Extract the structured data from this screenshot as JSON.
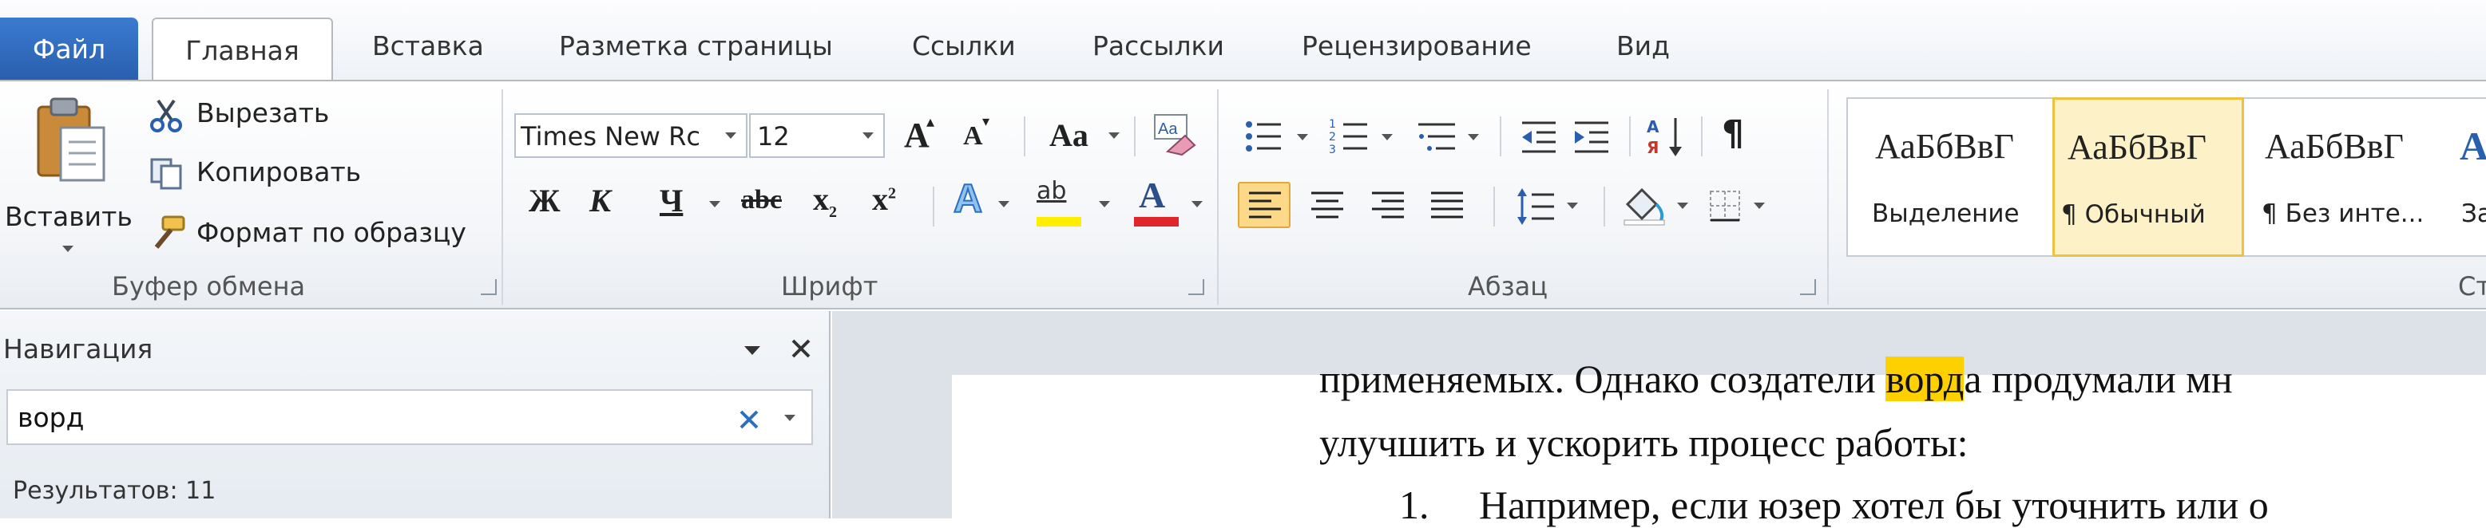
{
  "tabs": {
    "file": "Файл",
    "home": "Главная",
    "insert": "Вставка",
    "layout": "Разметка страницы",
    "references": "Ссылки",
    "mailings": "Рассылки",
    "review": "Рецензирование",
    "view": "Вид"
  },
  "clipboard": {
    "paste": "Вставить",
    "cut": "Вырезать",
    "copy": "Копировать",
    "format_painter": "Формат по образцу",
    "group_label": "Буфер обмена"
  },
  "font": {
    "name": "Times New Rc",
    "size": "12",
    "grow": "A",
    "shrink": "A",
    "case": "Aa",
    "bold": "Ж",
    "italic": "К",
    "underline": "Ч",
    "strike": "abc",
    "subscript": "x",
    "superscript": "x",
    "effects": "A",
    "highlight": "ab",
    "color": "A",
    "group_label": "Шрифт"
  },
  "paragraph": {
    "sort": "А Я",
    "pilcrow": "¶",
    "group_label": "Абзац"
  },
  "styles": {
    "items": [
      {
        "sample": "АаБбВвГ",
        "label": "Выделение"
      },
      {
        "sample": "АаБбВвГ",
        "label": "¶ Обычный"
      },
      {
        "sample": "АаБбВвГ",
        "label": "¶ Без инте..."
      },
      {
        "sample": "Aa",
        "label": "Заг"
      }
    ],
    "group_label": "Ст"
  },
  "navigation": {
    "title": "Навигация",
    "search_value": "ворд",
    "results": "Результатов: 11"
  },
  "document": {
    "line1_before": "применяемых. Однако создатели ",
    "line1_highlight": "ворд",
    "line1_after": "а продумали мн",
    "line2": "улучшить и ускорить процесс работы:",
    "line3_number": "1.",
    "line3": "Например, если юзер хотел бы уточнить или о"
  },
  "colors": {
    "file_tab": "#2a5fae",
    "highlight_yellow": "#ffd000",
    "font_color_red": "#e0262b",
    "selected_style_border": "#f0c040"
  }
}
